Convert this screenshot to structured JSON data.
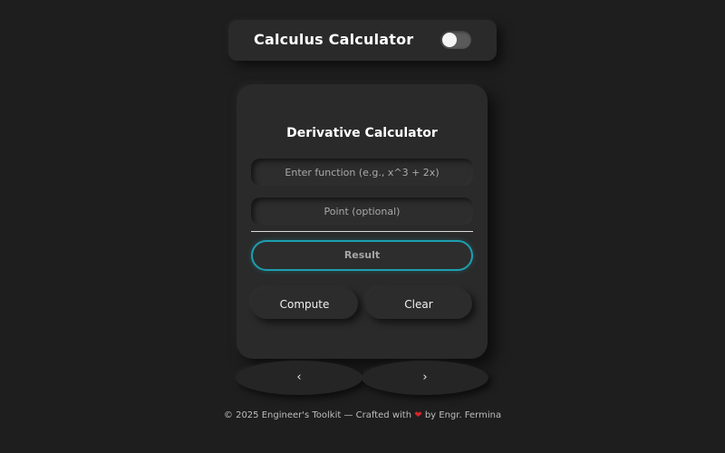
{
  "header": {
    "title": "Calculus Calculator",
    "theme_toggle": {
      "state": "off",
      "icon": "toggle-switch"
    }
  },
  "card": {
    "title": "Derivative Calculator",
    "function_input": {
      "value": "",
      "placeholder": "Enter function (e.g., x^3 + 2x)"
    },
    "point_input": {
      "value": "",
      "placeholder": "Point (optional)"
    },
    "result_label": "Result",
    "result_accent_color": "#1d9fb0",
    "compute_label": "Compute",
    "clear_label": "Clear"
  },
  "nav": {
    "prev_label": "‹",
    "next_label": "›"
  },
  "footer": {
    "text_before": "© 2025 Engineer's Toolkit — Crafted with",
    "heart": "❤",
    "heart_color": "#d4242a",
    "text_after": "by Engr. Fermina"
  },
  "colors": {
    "background": "#1e1e1e",
    "panel": "#2a2a2a"
  }
}
